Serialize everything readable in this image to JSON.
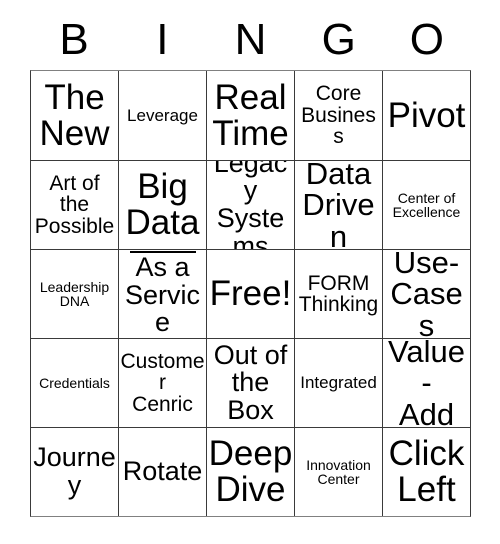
{
  "card": {
    "title": "BINGO",
    "header_letters": [
      "B",
      "I",
      "N",
      "G",
      "O"
    ],
    "colors": {
      "background": "#ffffff",
      "cell_background": "#ffffff",
      "grid_line": "#3a3a3a",
      "text": "#000000"
    },
    "rows": [
      {
        "cells": [
          {
            "text": "The\nNew",
            "size": "xxl",
            "blank_line": false
          },
          {
            "text": "Leverage",
            "size": "s",
            "blank_line": false
          },
          {
            "text": "Real\nTime",
            "size": "xxl",
            "blank_line": false
          },
          {
            "text": "Core\nBusiness",
            "size": "m",
            "blank_line": false
          },
          {
            "text": "Pivot",
            "size": "xxl",
            "blank_line": false
          }
        ]
      },
      {
        "cells": [
          {
            "text": "Art of\nthe\nPossible",
            "size": "m",
            "blank_line": false
          },
          {
            "text": "Big\nData",
            "size": "xxl",
            "blank_line": false
          },
          {
            "text": "Legacy\nSystems",
            "size": "l",
            "blank_line": false
          },
          {
            "text": "Data\nDriven",
            "size": "xl",
            "blank_line": false
          },
          {
            "text": "Center of\nExcellence",
            "size": "xs",
            "blank_line": false
          }
        ]
      },
      {
        "cells": [
          {
            "text": "Leadership\nDNA",
            "size": "xs",
            "blank_line": false
          },
          {
            "text": "As a\nService",
            "size": "l",
            "blank_line": true
          },
          {
            "text": "Free!",
            "size": "xxl",
            "blank_line": false
          },
          {
            "text": "FORM\nThinking",
            "size": "m",
            "blank_line": false
          },
          {
            "text": "Use-\nCases",
            "size": "xl",
            "blank_line": false
          }
        ]
      },
      {
        "cells": [
          {
            "text": "Credentials",
            "size": "xs",
            "blank_line": false
          },
          {
            "text": "Customer\nCenric",
            "size": "m",
            "blank_line": false
          },
          {
            "text": "Out of\nthe Box",
            "size": "l",
            "blank_line": false
          },
          {
            "text": "Integrated",
            "size": "s",
            "blank_line": false
          },
          {
            "text": "Value-\nAdd",
            "size": "xl",
            "blank_line": false
          }
        ]
      },
      {
        "cells": [
          {
            "text": "Journey",
            "size": "l",
            "blank_line": false
          },
          {
            "text": "Rotate",
            "size": "l",
            "blank_line": false
          },
          {
            "text": "Deep\nDive",
            "size": "xxl",
            "blank_line": false
          },
          {
            "text": "Innovation\nCenter",
            "size": "xs",
            "blank_line": false
          },
          {
            "text": "Click\nLeft",
            "size": "xxl",
            "blank_line": false
          }
        ]
      }
    ]
  }
}
